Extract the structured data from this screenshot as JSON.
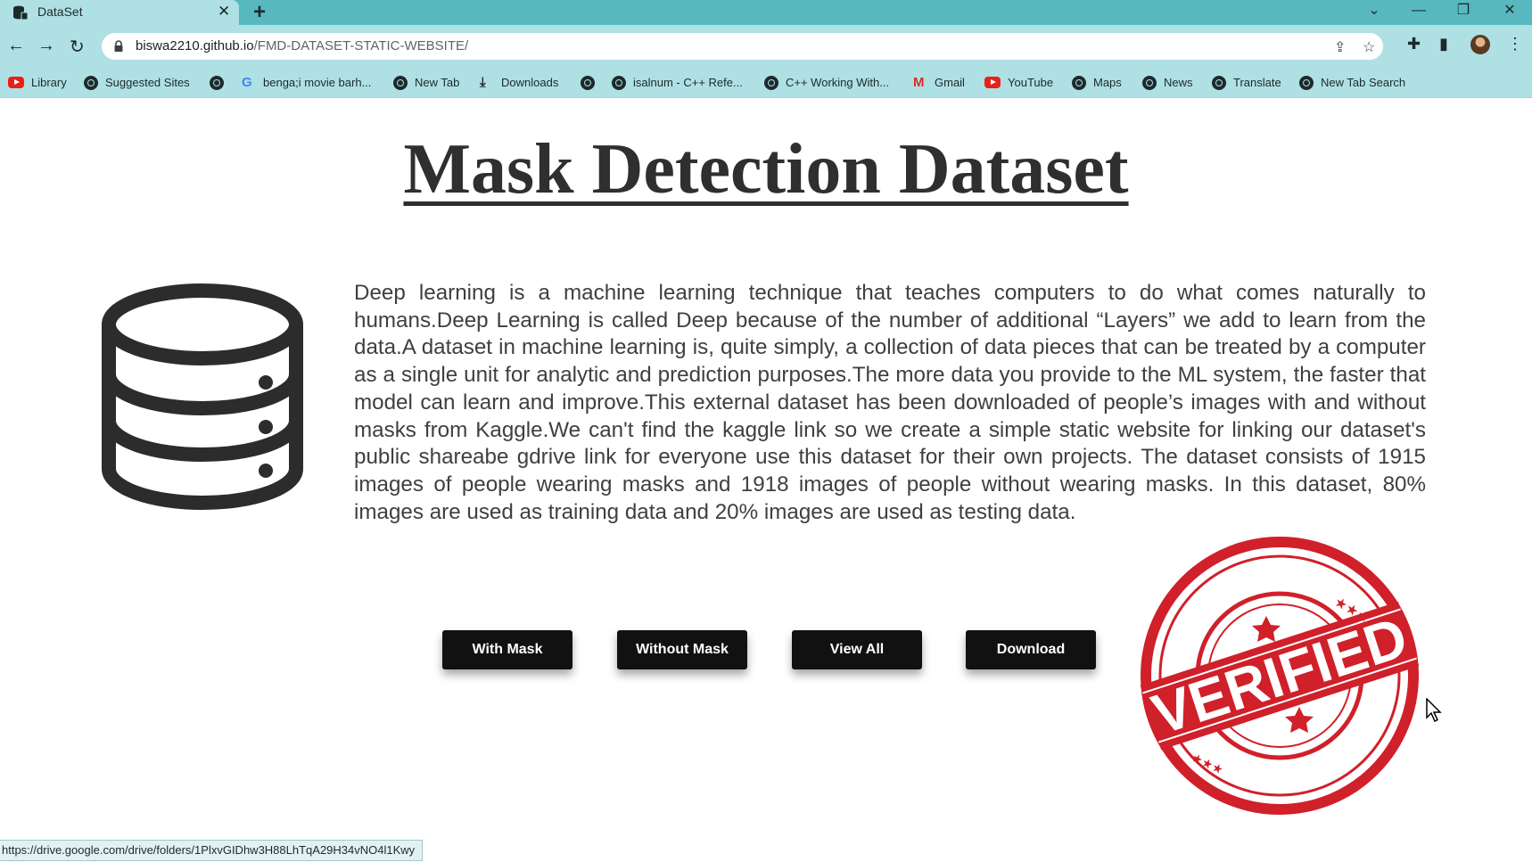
{
  "browser": {
    "tab_title": "DataSet",
    "tab_close": "✕",
    "new_tab": "+",
    "url_host": "biswa2210.github.io",
    "url_path": "/FMD-DATASET-STATIC-WEBSITE/",
    "bookmarks": [
      {
        "label": "Library",
        "icon": "youtube-icon"
      },
      {
        "label": "Suggested Sites",
        "icon": "globe-icon"
      },
      {
        "label": "",
        "icon": "globe-icon"
      },
      {
        "label": "benga;i movie barh...",
        "icon": "google-icon"
      },
      {
        "label": "New Tab",
        "icon": "globe-icon"
      },
      {
        "label": "Downloads",
        "icon": "download-icon"
      },
      {
        "label": "",
        "icon": "globe-icon"
      },
      {
        "label": "isalnum - C++ Refe...",
        "icon": "globe-icon"
      },
      {
        "label": "C++ Working With...",
        "icon": "globe-icon"
      },
      {
        "label": "Gmail",
        "icon": "gmail-icon"
      },
      {
        "label": "YouTube",
        "icon": "youtube-icon"
      },
      {
        "label": "Maps",
        "icon": "globe-icon"
      },
      {
        "label": "News",
        "icon": "globe-icon"
      },
      {
        "label": "Translate",
        "icon": "globe-icon"
      },
      {
        "label": "New Tab Search",
        "icon": "globe-icon"
      }
    ],
    "status_url": "https://drive.google.com/drive/folders/1PlxvGIDhw3H88LhTqA29H34vNO4l1Kwy",
    "accent_color": "#57b8c0",
    "toolbar_color": "#aee0e4"
  },
  "page": {
    "title": "Mask Detection Dataset",
    "description": "Deep learning is a machine learning technique that teaches computers to do what comes naturally to humans.Deep Learning is called Deep because of the number of additional “Layers” we add to learn from the data.A dataset in machine learning is, quite simply, a collection of data pieces that can be treated by a computer as a single unit for analytic and prediction purposes.The more data you provide to the ML system, the faster that model can learn and improve.This external dataset has been downloaded of people’s images with and without masks from Kaggle.We can't find the kaggle link so we create a simple static website for linking our dataset's public shareabe gdrive link for everyone use this dataset for their own projects. The dataset consists of 1915 images of people wearing masks and 1918 images of people without wearing masks. In this dataset, 80% images are used as training data and 20% images are used as testing data.",
    "buttons": {
      "with_mask": "With Mask",
      "without_mask": "Without Mask",
      "view_all": "View All",
      "download": "Download"
    },
    "stamp_text": "VERIFIED",
    "stamp_color": "#d0202a"
  }
}
